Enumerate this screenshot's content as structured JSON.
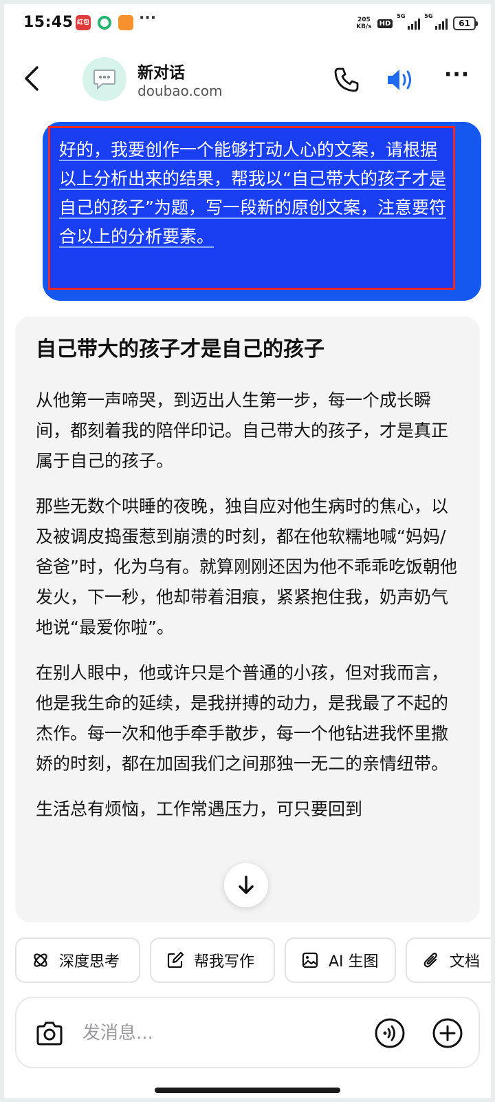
{
  "status_bar": {
    "time": "15:45",
    "app_badge": "红包",
    "speed_value": "205",
    "speed_unit": "KB/s",
    "hd_label": "HD",
    "signal1": "5G",
    "signal2": "5G",
    "battery": "61",
    "more": "···"
  },
  "header": {
    "title": "新对话",
    "subtitle": "doubao.com",
    "more": "···"
  },
  "user_message": {
    "text": "好的，我要创作一个能够打动人心的文案，请根据以上分析出来的结果，帮我以“自己带大的孩子才是自己的孩子”为题，写一段新的原创文案，注意要符合以上的分析要素。"
  },
  "answer": {
    "title": "自己带大的孩子才是自己的孩子",
    "paragraphs": [
      "从他第一声啼哭，到迈出人生第一步，每一个成长瞬间，都刻着我的陪伴印记。自己带大的孩子，才是真正属于自己的孩子。",
      "那些无数个哄睡的夜晚，独自应对他生病时的焦心，以及被调皮捣蛋惹到崩溃的时刻，都在他软糯地喊“妈妈/爸爸”时，化为乌有。就算刚刚还因为他不乖乖吃饭朝他发火，下一秒，他却带着泪痕，紧紧抱住我，奶声奶气地说“最爱你啦”。",
      "在别人眼中，他或许只是个普通的小孩，但对我而言，他是我生命的延续，是我拼搏的动力，是我最了不起的杰作。每一次和他手牵手散步，每一个他钻进我怀里撒娇的时刻，都在加固我们之间那独一无二的亲情纽带。",
      "生活总有烦恼，工作常遇压力，可只要回到"
    ]
  },
  "chips": [
    {
      "label": "深度思考",
      "icon": "atom-icon"
    },
    {
      "label": "帮我写作",
      "icon": "edit-icon"
    },
    {
      "label": "AI 生图",
      "icon": "image-icon"
    },
    {
      "label": "文档",
      "icon": "paperclip-icon"
    }
  ],
  "input": {
    "placeholder": "发消息..."
  },
  "colors": {
    "user_bubble": "#1558f0",
    "highlight_border": "#ee2828",
    "accent_speaker": "#1e6bf0",
    "card_bg": "#f4f4f5"
  }
}
